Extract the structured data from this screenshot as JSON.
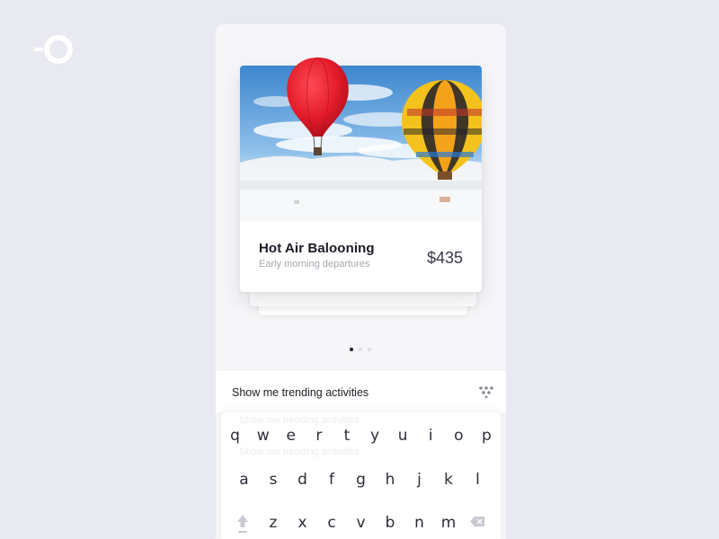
{
  "card": {
    "title": "Hot Air Balooning",
    "subtitle": "Early morning departures",
    "price": "$435"
  },
  "pager": {
    "count": 3,
    "active_index": 0
  },
  "input": {
    "query": "Show me trending activities"
  },
  "keyboard": {
    "ghost_suggestions": [
      "Show me trending activities",
      "Show me trending activities"
    ],
    "rows": [
      [
        "q",
        "w",
        "e",
        "r",
        "t",
        "y",
        "u",
        "i",
        "o",
        "p"
      ],
      [
        "a",
        "s",
        "d",
        "f",
        "g",
        "h",
        "j",
        "k",
        "l"
      ],
      [
        "z",
        "x",
        "c",
        "v",
        "b",
        "n",
        "m"
      ]
    ]
  },
  "icons": {
    "logo": "ring-logo-icon",
    "send": "dots-triangle-icon",
    "shift": "shift-arrow-icon",
    "backspace": "backspace-icon"
  },
  "colors": {
    "page_bg": "#e9e9f1",
    "card_bg": "#ffffff",
    "text_primary": "#1b1b26",
    "text_secondary": "#a6a6b2",
    "balloon_red": "#e31b2a",
    "balloon_yellow": "#f3c21c"
  }
}
